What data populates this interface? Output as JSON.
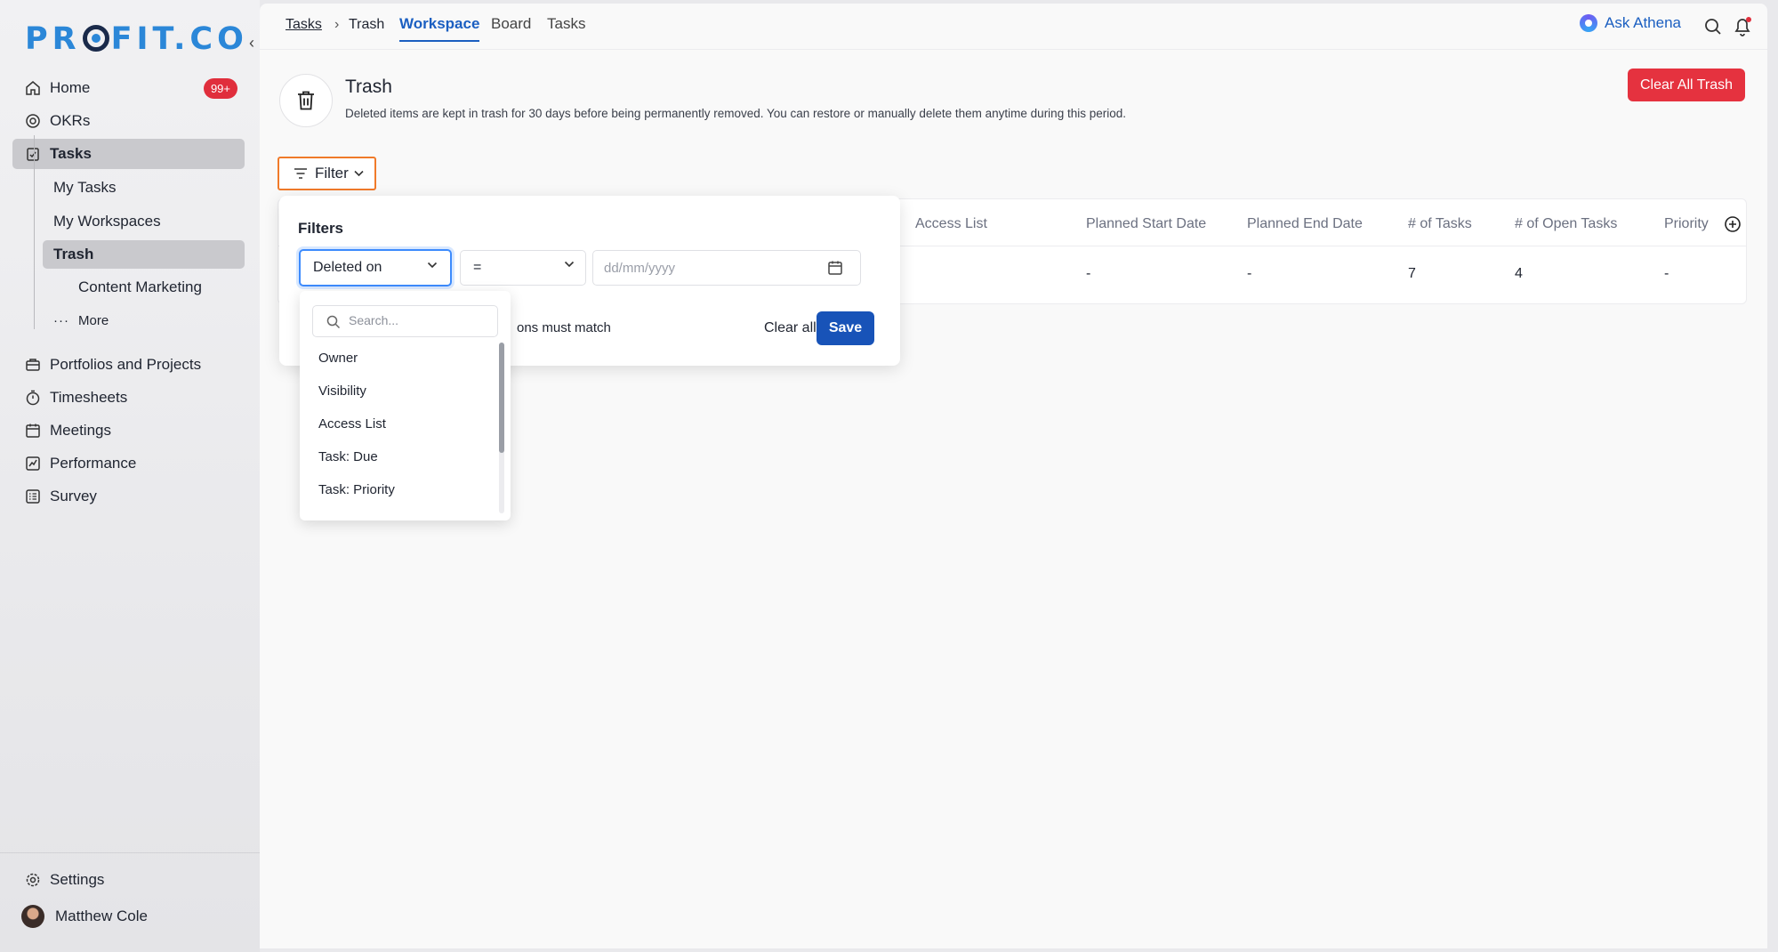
{
  "sidebar": {
    "logo": "PR FIT.CO",
    "logo_left": "PR",
    "logo_right": "FIT.CO",
    "items": [
      {
        "label": "Home",
        "badge": "99+"
      },
      {
        "label": "OKRs"
      },
      {
        "label": "Tasks"
      },
      {
        "label": "Portfolios and Projects"
      },
      {
        "label": "Timesheets"
      },
      {
        "label": "Meetings"
      },
      {
        "label": "Performance"
      },
      {
        "label": "Survey"
      }
    ],
    "subitems": [
      "My Tasks",
      "My Workspaces",
      "Trash",
      "Content Marketing",
      "More"
    ],
    "settings": "Settings",
    "user": "Matthew Cole"
  },
  "topbar": {
    "crumb_tasks": "Tasks",
    "crumb_sep": "›",
    "crumb_trash": "Trash",
    "tabs": [
      "Workspace",
      "Board",
      "Tasks"
    ],
    "ask": "Ask Athena"
  },
  "page": {
    "title": "Trash",
    "description": "Deleted items are kept in trash for 30 days before being permanently removed. You can restore or manually delete them anytime during this period.",
    "clear_all_trash": "Clear All Trash",
    "filter_label": "Filter"
  },
  "table": {
    "columns": [
      "Access List",
      "Planned Start Date",
      "Planned End Date",
      "# of Tasks",
      "# of Open Tasks",
      "Priority"
    ],
    "row": [
      "-",
      "-",
      "7",
      "4",
      "-"
    ]
  },
  "filter_panel": {
    "title": "Filters",
    "field": "Deleted on",
    "operator": "=",
    "date_placeholder": "dd/mm/yyyy",
    "match_text": "ons must match",
    "clear_all": "Clear all",
    "save": "Save"
  },
  "field_dropdown": {
    "search_placeholder": "Search...",
    "options": [
      "Owner",
      "Visibility",
      "Access List",
      "Task: Due",
      "Task: Priority"
    ]
  },
  "colors": {
    "accent": "#1b5fc1",
    "danger": "#e5323f",
    "filter_outline": "#f07a2a",
    "badge": "#e02e3c"
  }
}
